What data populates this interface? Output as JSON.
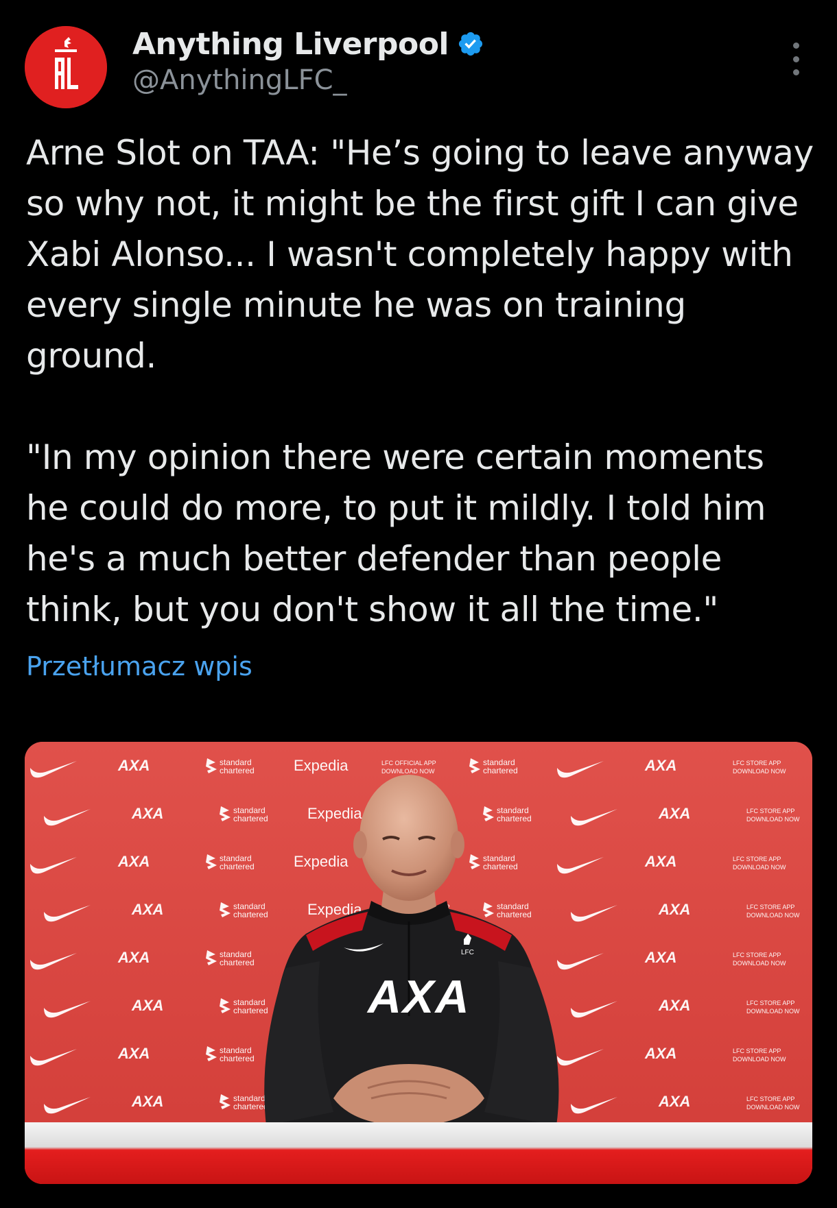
{
  "post": {
    "author": {
      "display_name": "Anything Liverpool",
      "handle": "@AnythingLFC_",
      "verified": true,
      "avatar_text": "AL",
      "avatar_color": "#e02020"
    },
    "text_paragraphs": [
      "Arne Slot on TAA: \"He’s going to leave anyway so why not, it might be the first gift I can give Xabi Alonso... I wasn't completely happy with every single minute he was on training ground.",
      "\"In my opinion there were certain moments he could do more, to put it mildly. I told him he's a much better defender than people think, but you don't show it all the time.\""
    ],
    "translate_label": "Przetłumacz wpis",
    "more_icon": "more-vertical-icon",
    "media": {
      "backdrop_color": "#d9453f",
      "sponsors": {
        "axa": "AXA",
        "expedia": "Expedia",
        "standard_line1": "standard",
        "standard_line2": "chartered",
        "lfc_app_line1": "LFC OFFICIAL APP",
        "lfc_app_line2": "DOWNLOAD NOW",
        "lfc_store_line1": "LFC STORE APP",
        "lfc_store_line2": "DOWNLOAD NOW"
      },
      "shirt_sponsor": "AXA",
      "crest_text": "LFC"
    }
  },
  "colors": {
    "background": "#000000",
    "text": "#e7e9ea",
    "secondary_text": "#8b9299",
    "link": "#4aa3ef",
    "verified_badge": "#1d9bf0"
  }
}
